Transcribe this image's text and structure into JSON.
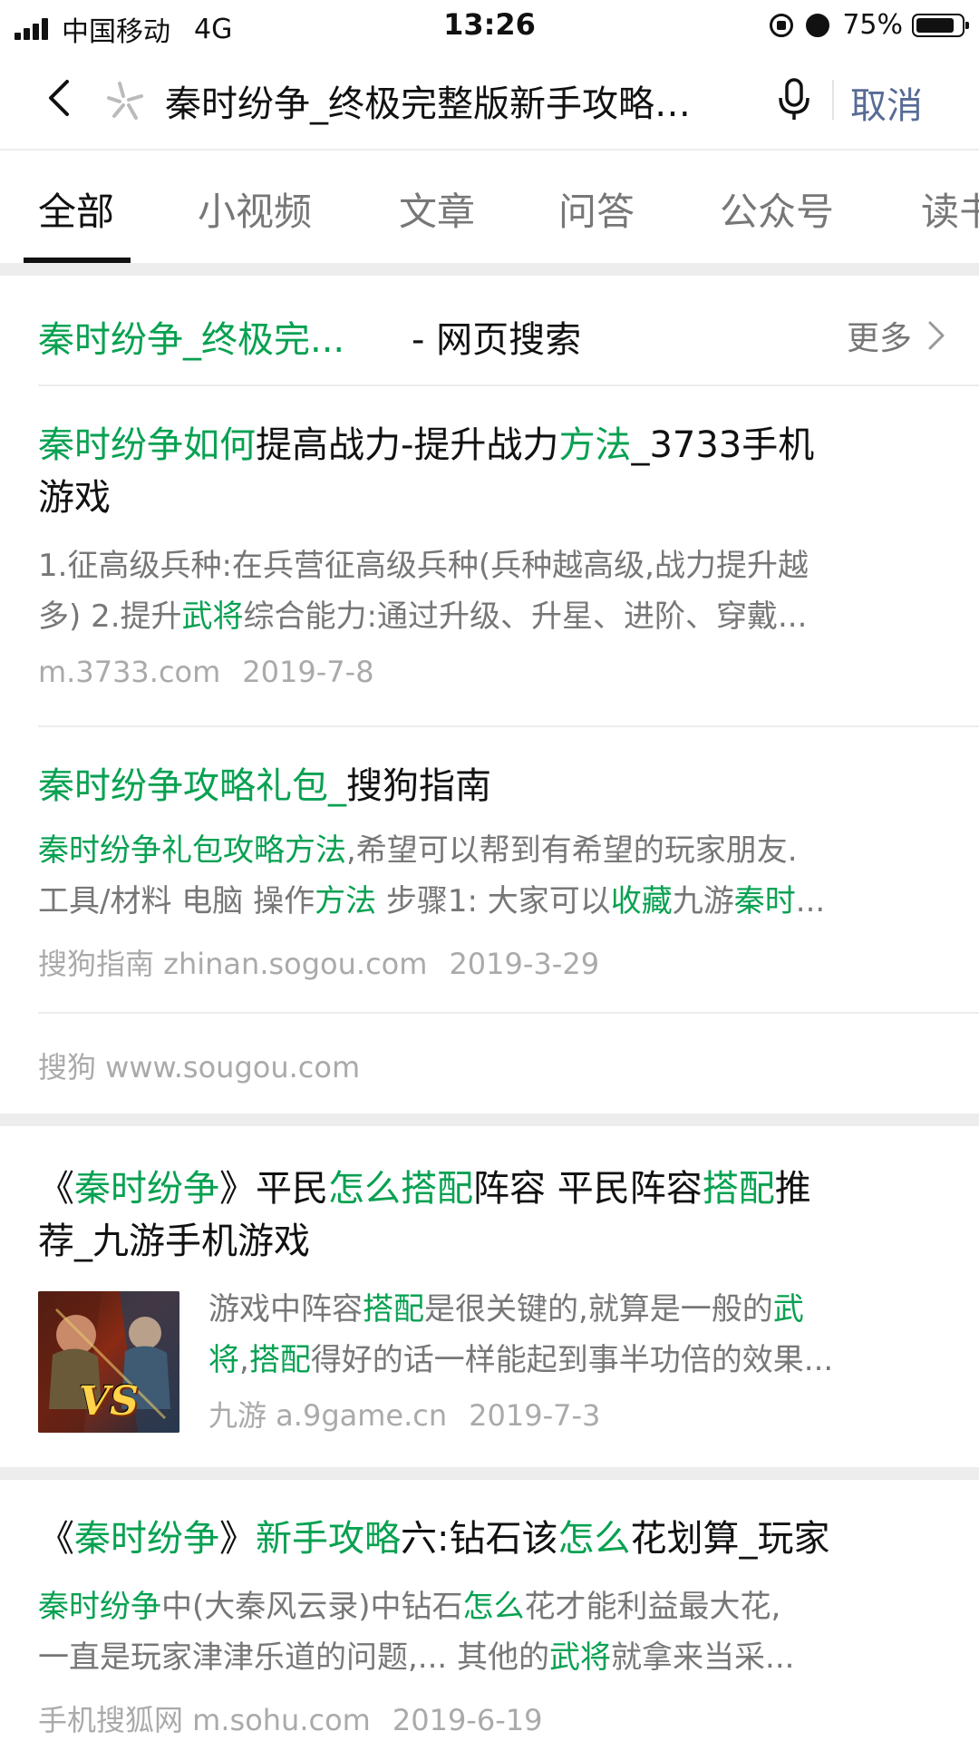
{
  "status_bar": {
    "carrier": "中国移动",
    "network": "4G",
    "time": "13:26",
    "battery": "75%",
    "battery_level": 0.75
  },
  "search": {
    "query": "秦时纷争_终极完整版新手攻略…",
    "cancel_label": "取消"
  },
  "tabs": [
    "全部",
    "小视频",
    "文章",
    "问答",
    "公众号",
    "读书"
  ],
  "web_block": {
    "header_green": "秦时纷争_终极完...",
    "header_suffix": "- 网页搜索",
    "more_label": "更多",
    "results": [
      {
        "title": [
          {
            "t": "秦时纷争如何",
            "g": true
          },
          {
            "t": "提高战力-提升战力",
            "g": false
          },
          {
            "t": "方法",
            "g": true
          },
          {
            "t": "_3733手机",
            "g": false
          },
          {
            "t": "游戏",
            "g": false
          }
        ],
        "snippet": [
          {
            "t": "1.征高级兵种:在兵营征高级兵种(兵种越高级,战力提升越",
            "g": false
          },
          {
            "t": "多) 2.提升",
            "g": false
          },
          {
            "t": "武将",
            "g": true
          },
          {
            "t": "综合能力:通过升级、升星、进阶、穿戴...",
            "g": false
          }
        ],
        "source": "m.3733.com",
        "date": "2019-7-8"
      },
      {
        "title": [
          {
            "t": "秦时纷争攻略礼包_",
            "g": true
          },
          {
            "t": "搜狗指南",
            "g": false
          }
        ],
        "snippet": [
          {
            "t": "秦时纷争礼包攻略方法",
            "g": true
          },
          {
            "t": ",希望可以帮到有希望的玩家朋友.",
            "g": false
          },
          {
            "t": "工具/材料 电脑 操作",
            "g": false
          },
          {
            "t": "方法",
            "g": true
          },
          {
            "t": " 步骤1: 大家可以",
            "g": false
          },
          {
            "t": "收藏",
            "g": true
          },
          {
            "t": "九游",
            "g": false
          },
          {
            "t": "秦时",
            "g": true
          },
          {
            "t": "...",
            "g": false
          }
        ],
        "source": "搜狗指南 zhinan.sogou.com",
        "date": "2019-3-29"
      }
    ],
    "footer_source": "搜狗 www.sougou.com"
  },
  "results": [
    {
      "title": [
        {
          "t": "《",
          "g": false
        },
        {
          "t": "秦时纷争",
          "g": true
        },
        {
          "t": "》平民",
          "g": false
        },
        {
          "t": "怎么搭配",
          "g": true
        },
        {
          "t": "阵容 平民阵容",
          "g": false
        },
        {
          "t": "搭配",
          "g": true
        },
        {
          "t": "推",
          "g": false
        },
        {
          "t": "荐_九游手机游戏",
          "g": false
        }
      ],
      "snippet": [
        {
          "t": "游戏中阵容",
          "g": false
        },
        {
          "t": "搭配",
          "g": true
        },
        {
          "t": "是很关键的,就算是一般的",
          "g": false
        },
        {
          "t": "武",
          "g": true
        },
        {
          "t": "将",
          "g": true
        },
        {
          "t": ",",
          "g": false
        },
        {
          "t": "搭配",
          "g": true
        },
        {
          "t": "得好的话一样能起到事半功倍的效果...",
          "g": false
        }
      ],
      "thumb_label": "VS",
      "source": "九游 a.9game.cn",
      "date": "2019-7-3"
    },
    {
      "title": [
        {
          "t": "《",
          "g": false
        },
        {
          "t": "秦时纷争",
          "g": true
        },
        {
          "t": "》",
          "g": false
        },
        {
          "t": "新手攻略",
          "g": true
        },
        {
          "t": "六:钻石该",
          "g": false
        },
        {
          "t": "怎么",
          "g": true
        },
        {
          "t": "花划算_玩家",
          "g": false
        }
      ],
      "snippet": [
        {
          "t": "秦时纷争",
          "g": true
        },
        {
          "t": "中(大秦风云录)中钻石",
          "g": false
        },
        {
          "t": "怎么",
          "g": true
        },
        {
          "t": "花才能利益最大花,",
          "g": false
        },
        {
          "t": "一直是玩家津津乐道的问题,... 其他的",
          "g": false
        },
        {
          "t": "武将",
          "g": true
        },
        {
          "t": "就拿来当采...",
          "g": false
        }
      ],
      "source": "手机搜狐网 m.sohu.com",
      "date": "2019-6-19"
    }
  ],
  "colors": {
    "keyword_green": "#07a151",
    "cancel_blue": "#576b95",
    "meta_gray": "#aaaaaa"
  }
}
